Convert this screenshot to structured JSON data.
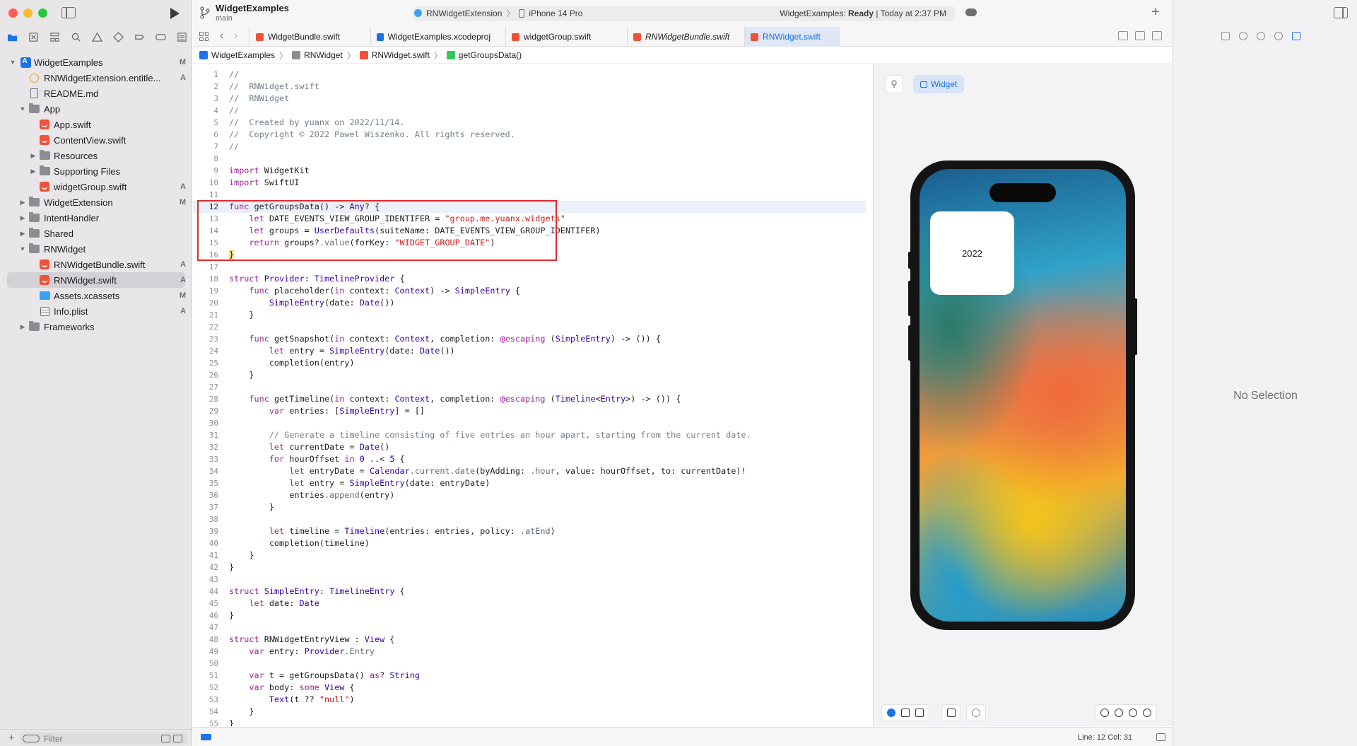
{
  "toolbar": {
    "project_title": "WidgetExamples",
    "branch": "main",
    "scheme": "RNWidgetExtension",
    "device": "iPhone 14 Pro",
    "status_prefix": "WidgetExamples: ",
    "status_state": "Ready",
    "status_suffix": " | Today at 2:37 PM"
  },
  "navigator": {
    "filter_placeholder": "Filter",
    "items": [
      {
        "label": "WidgetExamples",
        "badge": "M"
      },
      {
        "label": "RNWidgetExtension.entitle...",
        "badge": "A"
      },
      {
        "label": "README.md",
        "badge": ""
      },
      {
        "label": "App",
        "badge": ""
      },
      {
        "label": "App.swift",
        "badge": ""
      },
      {
        "label": "ContentView.swift",
        "badge": ""
      },
      {
        "label": "Resources",
        "badge": ""
      },
      {
        "label": "Supporting Files",
        "badge": ""
      },
      {
        "label": "widgetGroup.swift",
        "badge": "A"
      },
      {
        "label": "WidgetExtension",
        "badge": "M"
      },
      {
        "label": "IntentHandler",
        "badge": ""
      },
      {
        "label": "Shared",
        "badge": ""
      },
      {
        "label": "RNWidget",
        "badge": ""
      },
      {
        "label": "RNWidgetBundle.swift",
        "badge": "A"
      },
      {
        "label": "RNWidget.swift",
        "badge": "A"
      },
      {
        "label": "Assets.xcassets",
        "badge": "M"
      },
      {
        "label": "Info.plist",
        "badge": "A"
      },
      {
        "label": "Frameworks",
        "badge": ""
      }
    ]
  },
  "tabs": [
    {
      "label": "WidgetBundle.swift"
    },
    {
      "label": "WidgetExamples.xcodeproj"
    },
    {
      "label": "widgetGroup.swift"
    },
    {
      "label": "RNWidgetBundle.swift"
    },
    {
      "label": "RNWidget.swift"
    }
  ],
  "jumpbar": [
    "WidgetExamples",
    "RNWidget",
    "RNWidget.swift",
    "getGroupsData()"
  ],
  "code_lines": [
    "//",
    "//  RNWidget.swift",
    "//  RNWidget",
    "//",
    "//  Created by yuanx on 2022/11/14.",
    "//  Copyright © 2022 Pawel Wiszenko. All rights reserved.",
    "//",
    "",
    "import WidgetKit",
    "import SwiftUI",
    "",
    "func getGroupsData() -> Any? {",
    "    let DATE_EVENTS_VIEW_GROUP_IDENTIFER = \"group.me.yuanx.widgets\"",
    "    let groups = UserDefaults(suiteName: DATE_EVENTS_VIEW_GROUP_IDENTIFER)",
    "    return groups?.value(forKey: \"WIDGET_GROUP_DATE\")",
    "}",
    "",
    "struct Provider: TimelineProvider {",
    "    func placeholder(in context: Context) -> SimpleEntry {",
    "        SimpleEntry(date: Date())",
    "    }",
    "",
    "    func getSnapshot(in context: Context, completion: @escaping (SimpleEntry) -> ()) {",
    "        let entry = SimpleEntry(date: Date())",
    "        completion(entry)",
    "    }",
    "",
    "    func getTimeline(in context: Context, completion: @escaping (Timeline<Entry>) -> ()) {",
    "        var entries: [SimpleEntry] = []",
    "",
    "        // Generate a timeline consisting of five entries an hour apart, starting from the current date.",
    "        let currentDate = Date()",
    "        for hourOffset in 0 ..< 5 {",
    "            let entryDate = Calendar.current.date(byAdding: .hour, value: hourOffset, to: currentDate)!",
    "            let entry = SimpleEntry(date: entryDate)",
    "            entries.append(entry)",
    "        }",
    "",
    "        let timeline = Timeline(entries: entries, policy: .atEnd)",
    "        completion(timeline)",
    "    }",
    "}",
    "",
    "struct SimpleEntry: TimelineEntry {",
    "    let date: Date",
    "}",
    "",
    "struct RNWidgetEntryView : View {",
    "    var entry: Provider.Entry",
    "",
    "    var t = getGroupsData() as? String",
    "    var body: some View {",
    "        Text(t ?? \"null\")",
    "    }",
    "}"
  ],
  "canvas": {
    "widget_button": "Widget",
    "widget_text": "2022"
  },
  "inspector": {
    "empty_text": "No Selection"
  },
  "statusbar": {
    "line_col": "Line: 12  Col: 31"
  },
  "colors": {
    "accent": "#1a73e8",
    "swift_orange": "#f05138",
    "highlight_box": "#e02b2b"
  }
}
